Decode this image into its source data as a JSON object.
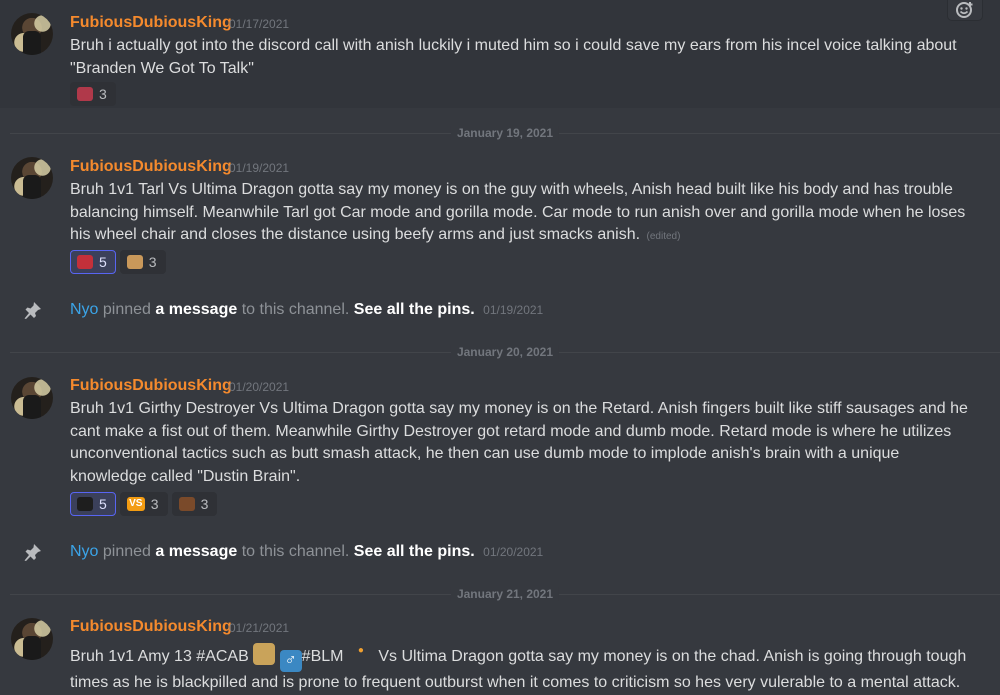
{
  "messages": [
    {
      "author": "FubiousDubiousKing",
      "date": "01/17/2021",
      "lines": [
        "Bruh i actually got into the discord call with anish luckily i muted him so i could save my ears from his incel voice talking about",
        "\"Branden We Got To Talk\""
      ],
      "reactions": [
        {
          "emoji": "emoji-face",
          "count": "3",
          "color": "#b0394a"
        }
      ]
    },
    {
      "author": "FubiousDubiousKing",
      "date": "01/19/2021",
      "lines": [
        "Bruh 1v1 Tarl Vs Ultima Dragon gotta say my money is on the guy with wheels, Anish head built like his body and has trouble",
        "balancing himself. Meanwhile Tarl got Car mode and gorilla mode. Car mode to run anish over and gorilla mode when he loses",
        "his wheel chair and closes the distance using beefy arms and just smacks anish."
      ],
      "edited": "(edited)",
      "reactions": [
        {
          "emoji": "emoji-flag",
          "count": "5",
          "color": "#c4303a"
        },
        {
          "emoji": "emoji-hand",
          "count": "3",
          "color": "#c9985a"
        }
      ]
    },
    {
      "author": "FubiousDubiousKing",
      "date": "01/20/2021",
      "lines": [
        "Bruh 1v1 Girthy Destroyer Vs Ultima Dragon gotta say my money is on the Retard. Anish fingers built like stiff sausages and he",
        "cant make a fist out of them. Meanwhile Girthy Destroyer got retard mode and dumb mode. Retard mode is where he utilizes",
        "unconventional tactics such as butt smash attack, he then can use dumb mode to implode anish's brain with a unique",
        "knowledge called \"Dustin Brain\"."
      ],
      "reactions": [
        {
          "emoji": "emoji-dark",
          "count": "5",
          "color": "#1e1e1e"
        },
        {
          "emoji": "emoji-vs",
          "count": "3",
          "color": "#f39c12",
          "text": "VS"
        },
        {
          "emoji": "emoji-person",
          "count": "3",
          "color": "#7a4a2a"
        }
      ]
    },
    {
      "author": "FubiousDubiousKing",
      "date": "01/21/2021",
      "line1_a": "Bruh 1v1 Amy 13 #ACAB",
      "line1_b": "#BLM",
      "line1_c": "Vs Ultima Dragon gotta say my money is on the chad. Anish is going through tough",
      "line2": "times as he is blackpilled and is prone to frequent outburst when it comes to criticism so hes very vulerable to a mental attack."
    }
  ],
  "dividers": [
    "January 19, 2021",
    "January 20, 2021",
    "January 21, 2021"
  ],
  "pins": [
    {
      "who": "Nyo",
      "pinned": "pinned",
      "a_message": "a message",
      "to_channel": "to this channel.",
      "see_all": "See all the pins.",
      "date": "01/19/2021"
    },
    {
      "who": "Nyo",
      "pinned": "pinned",
      "a_message": "a message",
      "to_channel": "to this channel.",
      "see_all": "See all the pins.",
      "date": "01/20/2021"
    }
  ],
  "colors": {
    "background": "#36393f",
    "author": "#f58a2d",
    "mention": "#3ba4e8",
    "reaction_me_border": "#5865f2"
  },
  "icons": {
    "add_reaction": "add-reaction-icon",
    "pin": "pin-icon"
  }
}
